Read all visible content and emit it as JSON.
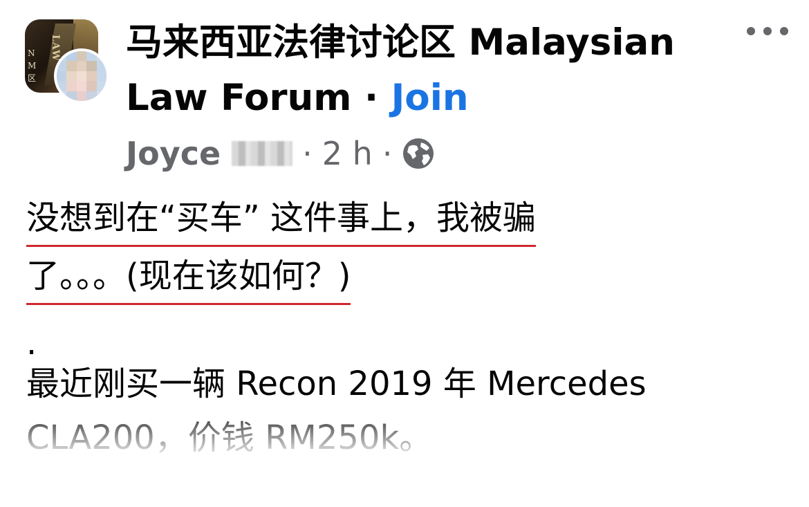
{
  "group": {
    "name": "马来西亚法律讨论区 Malaysian Law Forum",
    "separator": "·",
    "join_label": "Join"
  },
  "post": {
    "author": "Joyce",
    "time": "2 h",
    "separator": "·",
    "title_line_1": "没想到在“买车” 这件事上，我被骗",
    "title_line_2": "了。。。(现在该如何？)",
    "dot_line": ".",
    "body_line_1": "最近刚买一辆 Recon 2019 年 Mercedes",
    "body_line_2": "CLA200，价钱 RM250k。"
  },
  "icons": {
    "more": "more-options-icon",
    "privacy": "globe-icon"
  },
  "colors": {
    "join_link": "#1b74e4",
    "meta_text": "#65676b",
    "underline": "#d0282e",
    "body_text": "#050505"
  }
}
